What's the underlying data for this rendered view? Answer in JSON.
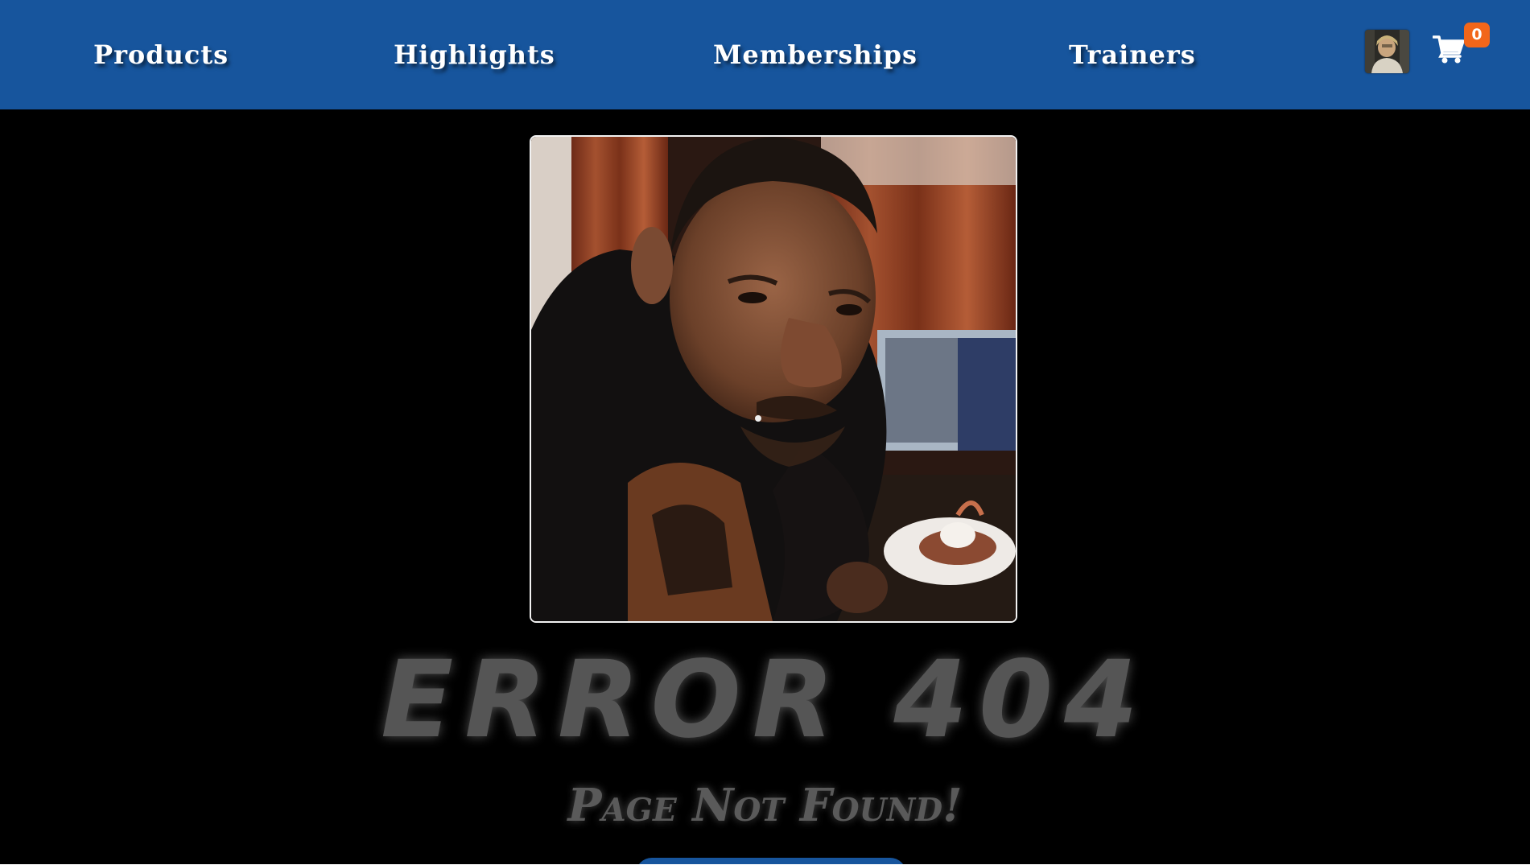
{
  "nav": {
    "items": [
      {
        "label": "Products"
      },
      {
        "label": "Highlights"
      },
      {
        "label": "Memberships"
      },
      {
        "label": "Trainers"
      }
    ],
    "cart_count": "0",
    "background_color": "#17559d",
    "badge_color": "#f2661a"
  },
  "main": {
    "error_title": "ERROR 404",
    "error_subtitle": "Page Not Found!",
    "text_color": "#555555"
  },
  "icons": {
    "cart": "shopping-cart-icon",
    "avatar": "user-avatar-image"
  }
}
